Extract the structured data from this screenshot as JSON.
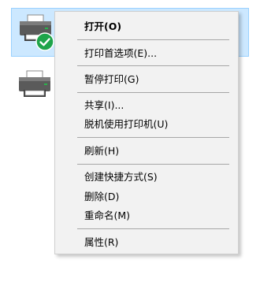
{
  "printers": [
    {
      "state": "selected",
      "default": true
    },
    {
      "state": "normal",
      "default": false
    }
  ],
  "context_menu": {
    "items": [
      {
        "label": "打开(O)",
        "bold": true
      },
      {
        "label": "打印首选项(E)..."
      },
      {
        "label": "暂停打印(G)"
      },
      {
        "label": "共享(I)..."
      },
      {
        "label": "脱机使用打印机(U)"
      },
      {
        "label": "刷新(H)"
      },
      {
        "label": "创建快捷方式(S)"
      },
      {
        "label": "删除(D)"
      },
      {
        "label": "重命名(M)"
      },
      {
        "label": "属性(R)"
      }
    ]
  },
  "colors": {
    "selection_bg": "#cce8ff",
    "selection_border": "#99d1ff",
    "menu_bg": "#f2f2f2",
    "default_badge": "#1ea44a"
  },
  "icons": {
    "printer": "printer-icon",
    "default_badge": "default-printer-check-icon"
  }
}
